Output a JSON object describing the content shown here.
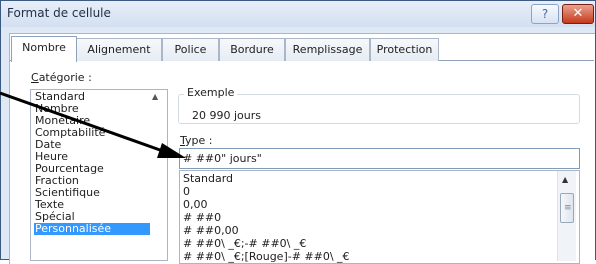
{
  "window": {
    "title": "Format de cellule",
    "help_label": "?",
    "close_label": "✕"
  },
  "tabs": [
    {
      "label": "Nombre",
      "active": true
    },
    {
      "label": "Alignement",
      "active": false
    },
    {
      "label": "Police",
      "active": false
    },
    {
      "label": "Bordure",
      "active": false
    },
    {
      "label": "Remplissage",
      "active": false
    },
    {
      "label": "Protection",
      "active": false
    }
  ],
  "category": {
    "label_prefix": "C",
    "label_rest": "atégorie :",
    "items": [
      "Standard",
      "Nombre",
      "Monétaire",
      "Comptabilité",
      "Date",
      "Heure",
      "Pourcentage",
      "Fraction",
      "Scientifique",
      "Texte",
      "Spécial",
      "Personnalisée"
    ],
    "selected": "Personnalisée"
  },
  "sample": {
    "legend": "Exemple",
    "value": "20 990 jours"
  },
  "type": {
    "label_prefix": "T",
    "label_rest": "ype :",
    "input_value": "# ##0\" jours\"",
    "formats": [
      "Standard",
      "0",
      "0,00",
      "# ##0",
      "# ##0,00",
      "# ##0\\ _€;-# ##0\\ _€",
      "# ##0\\ _€;[Rouge]-# ##0\\ _€"
    ]
  },
  "colors": {
    "selection": "#3399ff",
    "window_border": "#3b5a82",
    "close_button": "#c5391c",
    "arrow": "#000000"
  }
}
